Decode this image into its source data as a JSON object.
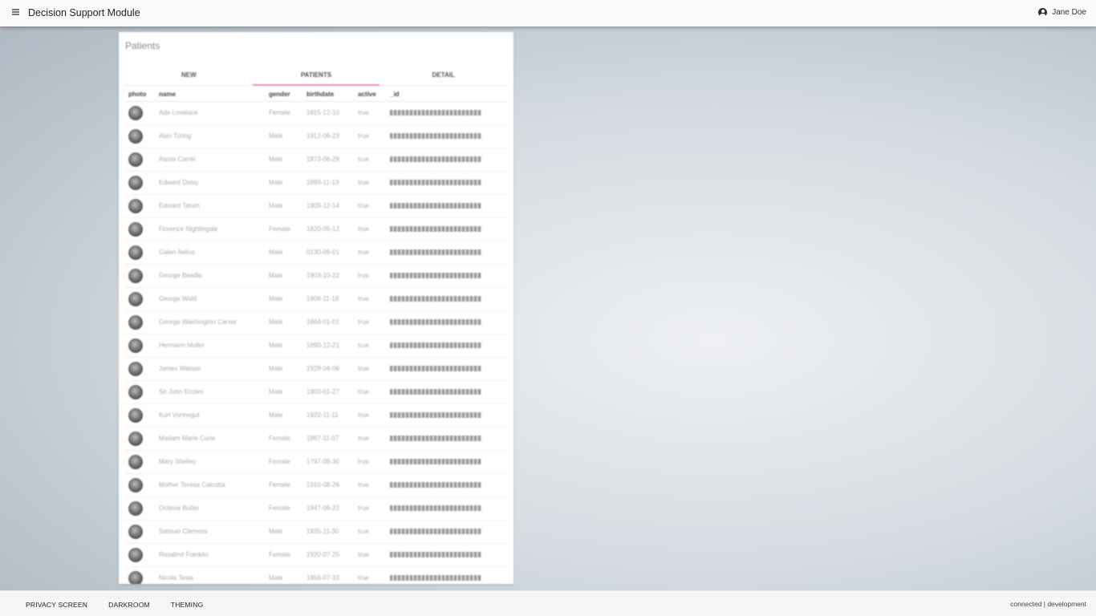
{
  "header": {
    "title": "Decision Support Module",
    "user_name": "Jane Doe"
  },
  "card": {
    "title": "Patients",
    "tabs": [
      {
        "label": "NEW",
        "active": false
      },
      {
        "label": "PATIENTS",
        "active": true
      },
      {
        "label": "DETAIL",
        "active": false
      }
    ],
    "columns": [
      "photo",
      "name",
      "gender",
      "birthdate",
      "active",
      "_id"
    ],
    "rows": [
      {
        "name": "Ada Lovelace",
        "gender": "Female",
        "birthdate": "1815-12-10",
        "active": "true"
      },
      {
        "name": "Alan Turing",
        "gender": "Male",
        "birthdate": "1912-06-23",
        "active": "true"
      },
      {
        "name": "Alexis Carrel",
        "gender": "Male",
        "birthdate": "1873-06-28",
        "active": "true"
      },
      {
        "name": "Edward Doisy",
        "gender": "Male",
        "birthdate": "1893-11-13",
        "active": "true"
      },
      {
        "name": "Edward Tatum",
        "gender": "Male",
        "birthdate": "1909-12-14",
        "active": "true"
      },
      {
        "name": "Florence Nightingale",
        "gender": "Female",
        "birthdate": "1820-05-12",
        "active": "true"
      },
      {
        "name": "Galen Aelius",
        "gender": "Male",
        "birthdate": "0130-09-01",
        "active": "true"
      },
      {
        "name": "George Beadle",
        "gender": "Male",
        "birthdate": "1903-10-22",
        "active": "true"
      },
      {
        "name": "George Wald",
        "gender": "Male",
        "birthdate": "1906-11-18",
        "active": "true"
      },
      {
        "name": "George Washington Carver",
        "gender": "Male",
        "birthdate": "1864-01-01",
        "active": "true"
      },
      {
        "name": "Hermann Muller",
        "gender": "Male",
        "birthdate": "1890-12-21",
        "active": "true"
      },
      {
        "name": "James Watson",
        "gender": "Male",
        "birthdate": "1928-04-06",
        "active": "true"
      },
      {
        "name": "Sir John Eccles",
        "gender": "Male",
        "birthdate": "1903-01-27",
        "active": "true"
      },
      {
        "name": "Kurt Vonnegut",
        "gender": "Male",
        "birthdate": "1922-11-11",
        "active": "true"
      },
      {
        "name": "Madam Marie Curie",
        "gender": "Female",
        "birthdate": "1867-11-07",
        "active": "true"
      },
      {
        "name": "Mary Shelley",
        "gender": "Female",
        "birthdate": "1797-08-30",
        "active": "true"
      },
      {
        "name": "Mother Teresa Calcutta",
        "gender": "Female",
        "birthdate": "1910-08-26",
        "active": "true"
      },
      {
        "name": "Octavia Butler",
        "gender": "Female",
        "birthdate": "1947-06-22",
        "active": "true"
      },
      {
        "name": "Samuel Clemens",
        "gender": "Male",
        "birthdate": "1835-11-30",
        "active": "true"
      },
      {
        "name": "Rosalind Franklin",
        "gender": "Female",
        "birthdate": "1920-07-25",
        "active": "true"
      },
      {
        "name": "Nicola Tesla",
        "gender": "Male",
        "birthdate": "1856-07-10",
        "active": "true"
      }
    ]
  },
  "footer": {
    "links": [
      "PRIVACY SCREEN",
      "DARKROOM",
      "THEMING"
    ],
    "status": "connected | development"
  }
}
